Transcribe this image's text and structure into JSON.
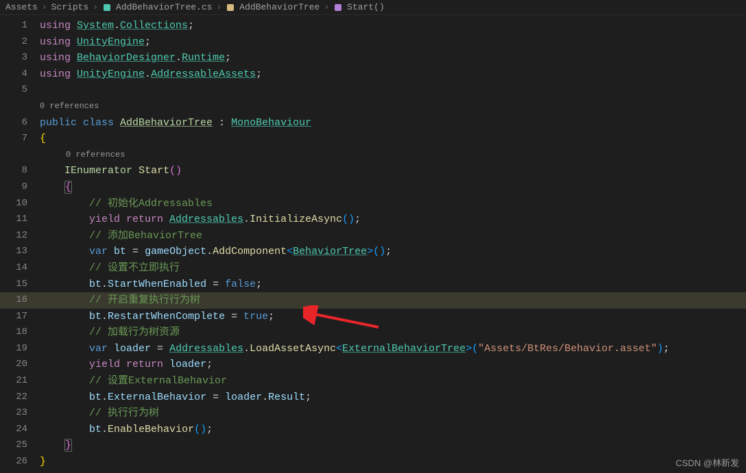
{
  "breadcrumb": {
    "items": [
      {
        "label": "Assets"
      },
      {
        "label": "Scripts"
      },
      {
        "label": "AddBehaviorTree.cs",
        "iconColor": "#4ec9b0"
      },
      {
        "label": "AddBehaviorTree",
        "iconColor": "#d7ba7d"
      },
      {
        "label": "Start()",
        "iconColor": "#b180d7"
      }
    ],
    "sep": "›"
  },
  "references": {
    "class": "0 references",
    "method": "0 references"
  },
  "code": {
    "lines": [
      {
        "n": 1,
        "tokens": [
          [
            "using ",
            "key"
          ],
          [
            "System",
            "ns"
          ],
          [
            ".",
            "p"
          ],
          [
            "Collections",
            "ns"
          ],
          [
            ";",
            "p"
          ]
        ]
      },
      {
        "n": 2,
        "tokens": [
          [
            "using ",
            "key"
          ],
          [
            "UnityEngine",
            "ns"
          ],
          [
            ";",
            "p"
          ]
        ]
      },
      {
        "n": 3,
        "tokens": [
          [
            "using ",
            "key"
          ],
          [
            "BehaviorDesigner",
            "ns"
          ],
          [
            ".",
            "p"
          ],
          [
            "Runtime",
            "ns"
          ],
          [
            ";",
            "p"
          ]
        ]
      },
      {
        "n": 4,
        "tokens": [
          [
            "using ",
            "key"
          ],
          [
            "UnityEngine",
            "ns"
          ],
          [
            ".",
            "p"
          ],
          [
            "AddressableAssets",
            "ns"
          ],
          [
            ";",
            "p"
          ]
        ]
      },
      {
        "n": 5,
        "tokens": []
      },
      {
        "ref": "class",
        "indent": 0
      },
      {
        "n": 6,
        "tokens": [
          [
            "public ",
            "kw2"
          ],
          [
            "class ",
            "kw2"
          ],
          [
            "AddBehaviorTree",
            "cls"
          ],
          [
            " : ",
            "p"
          ],
          [
            "MonoBehaviour",
            "type"
          ]
        ]
      },
      {
        "n": 7,
        "tokens": [
          [
            "{",
            "punc"
          ]
        ]
      },
      {
        "ref": "method",
        "indent": 1
      },
      {
        "n": 8,
        "indent": 1,
        "tokens": [
          [
            "IEnumerator",
            "clsN"
          ],
          [
            " ",
            "p"
          ],
          [
            "Start",
            "fn"
          ],
          [
            "()",
            "punc2"
          ]
        ]
      },
      {
        "n": 9,
        "indent": 1,
        "tokens": [
          [
            "{",
            "punc2"
          ]
        ],
        "box": true
      },
      {
        "n": 10,
        "indent": 2,
        "tokens": [
          [
            "// 初始化Addressables",
            "cmt"
          ]
        ]
      },
      {
        "n": 11,
        "indent": 2,
        "tokens": [
          [
            "yield ",
            "key"
          ],
          [
            "return ",
            "key"
          ],
          [
            "Addressables",
            "type"
          ],
          [
            ".",
            "p"
          ],
          [
            "InitializeAsync",
            "fn"
          ],
          [
            "()",
            "punc3"
          ],
          [
            ";",
            "p"
          ]
        ]
      },
      {
        "n": 12,
        "indent": 2,
        "tokens": [
          [
            "// 添加BehaviorTree",
            "cmt"
          ]
        ]
      },
      {
        "n": 13,
        "indent": 2,
        "tokens": [
          [
            "var ",
            "kw2"
          ],
          [
            "bt",
            "var"
          ],
          [
            " = ",
            "p"
          ],
          [
            "gameObject",
            "var"
          ],
          [
            ".",
            "p"
          ],
          [
            "AddComponent",
            "fn"
          ],
          [
            "<",
            "punc3"
          ],
          [
            "BehaviorTree",
            "type"
          ],
          [
            ">",
            "punc3"
          ],
          [
            "()",
            "punc3"
          ],
          [
            ";",
            "p"
          ]
        ]
      },
      {
        "n": 14,
        "indent": 2,
        "tokens": [
          [
            "// 设置不立即执行",
            "cmt"
          ]
        ]
      },
      {
        "n": 15,
        "indent": 2,
        "tokens": [
          [
            "bt",
            "var"
          ],
          [
            ".",
            "p"
          ],
          [
            "StartWhenEnabled",
            "var"
          ],
          [
            " = ",
            "p"
          ],
          [
            "false",
            "kw2"
          ],
          [
            ";",
            "p"
          ]
        ]
      },
      {
        "n": 16,
        "indent": 2,
        "highlight": true,
        "tokens": [
          [
            "// 开启重复执行行为树",
            "cmt"
          ]
        ]
      },
      {
        "n": 17,
        "indent": 2,
        "tokens": [
          [
            "bt",
            "var"
          ],
          [
            ".",
            "p"
          ],
          [
            "RestartWhenComplete",
            "var"
          ],
          [
            " = ",
            "p"
          ],
          [
            "true",
            "kw2"
          ],
          [
            ";",
            "p"
          ]
        ]
      },
      {
        "n": 18,
        "indent": 2,
        "tokens": [
          [
            "// 加载行为树资源",
            "cmt"
          ]
        ]
      },
      {
        "n": 19,
        "indent": 2,
        "tokens": [
          [
            "var ",
            "kw2"
          ],
          [
            "loader",
            "var"
          ],
          [
            " = ",
            "p"
          ],
          [
            "Addressables",
            "type"
          ],
          [
            ".",
            "p"
          ],
          [
            "LoadAssetAsync",
            "fn"
          ],
          [
            "<",
            "punc3"
          ],
          [
            "ExternalBehaviorTree",
            "type"
          ],
          [
            ">",
            "punc3"
          ],
          [
            "(",
            "punc3"
          ],
          [
            "\"Assets/BtRes/Behavior.asset\"",
            "str"
          ],
          [
            ")",
            "punc3"
          ],
          [
            ";",
            "p"
          ]
        ]
      },
      {
        "n": 20,
        "indent": 2,
        "tokens": [
          [
            "yield ",
            "key"
          ],
          [
            "return ",
            "key"
          ],
          [
            "loader",
            "var"
          ],
          [
            ";",
            "p"
          ]
        ]
      },
      {
        "n": 21,
        "indent": 2,
        "tokens": [
          [
            "// 设置ExternalBehavior",
            "cmt"
          ]
        ]
      },
      {
        "n": 22,
        "indent": 2,
        "tokens": [
          [
            "bt",
            "var"
          ],
          [
            ".",
            "p"
          ],
          [
            "ExternalBehavior",
            "var"
          ],
          [
            " = ",
            "p"
          ],
          [
            "loader",
            "var"
          ],
          [
            ".",
            "p"
          ],
          [
            "Result",
            "var"
          ],
          [
            ";",
            "p"
          ]
        ]
      },
      {
        "n": 23,
        "indent": 2,
        "tokens": [
          [
            "// 执行行为树",
            "cmt"
          ]
        ]
      },
      {
        "n": 24,
        "indent": 2,
        "tokens": [
          [
            "bt",
            "var"
          ],
          [
            ".",
            "p"
          ],
          [
            "EnableBehavior",
            "fn"
          ],
          [
            "()",
            "punc3"
          ],
          [
            ";",
            "p"
          ]
        ]
      },
      {
        "n": 25,
        "indent": 1,
        "tokens": [
          [
            "}",
            "punc2"
          ]
        ],
        "box": true
      },
      {
        "n": 26,
        "tokens": [
          [
            "}",
            "punc"
          ]
        ]
      }
    ]
  },
  "watermark": "CSDN @林新发",
  "highlighted_line": 16
}
